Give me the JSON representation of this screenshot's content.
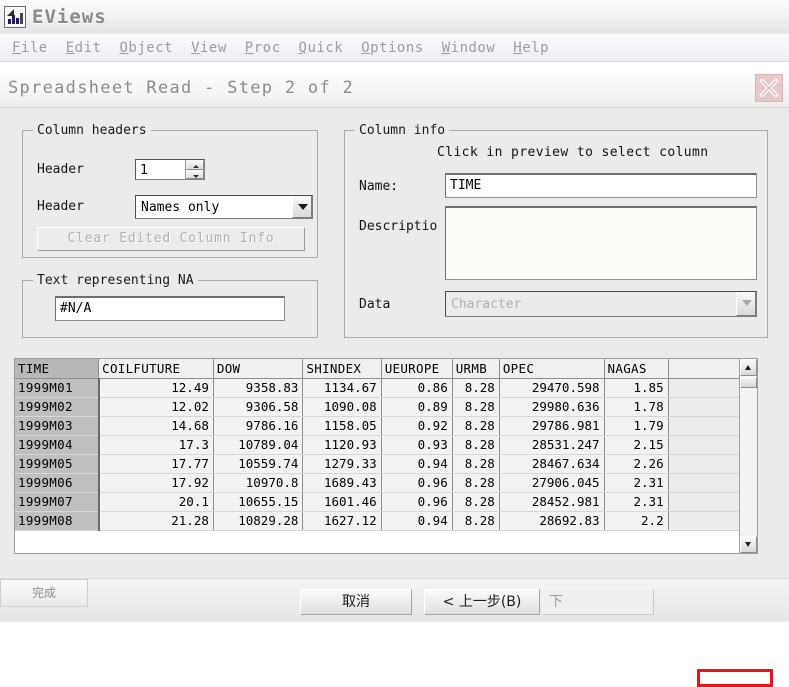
{
  "app": {
    "title": "EViews",
    "icon": "eviews-app-icon"
  },
  "menubar": {
    "items": [
      {
        "label": "File",
        "mnemonic": "F"
      },
      {
        "label": "Edit",
        "mnemonic": "E"
      },
      {
        "label": "Object",
        "mnemonic": "O"
      },
      {
        "label": "View",
        "mnemonic": "V"
      },
      {
        "label": "Proc",
        "mnemonic": "P"
      },
      {
        "label": "Quick",
        "mnemonic": "Q"
      },
      {
        "label": "Options",
        "mnemonic": "O"
      },
      {
        "label": "Window",
        "mnemonic": "W"
      },
      {
        "label": "Help",
        "mnemonic": "H"
      }
    ]
  },
  "dialog": {
    "title": "Spreadsheet Read - Step 2 of 2",
    "close_icon": "close-x-icon",
    "column_headers": {
      "group_title": "Column headers",
      "header_count_label": "Header",
      "header_count_value": "1",
      "header_type_label": "Header",
      "header_type_value": "Names only",
      "clear_button_label": "Clear Edited Column Info",
      "clear_button_enabled": false
    },
    "na_text": {
      "group_title": "Text representing NA",
      "value": "#N/A"
    },
    "column_info": {
      "group_title": "Column info",
      "hint": "Click in preview to select column",
      "name_label": "Name:",
      "name_value": "TIME",
      "description_label": "Descriptio",
      "description_value": "",
      "data_label": "Data",
      "data_value": "Character",
      "data_enabled": false
    },
    "buttons": {
      "cancel": "取消",
      "back": "< 上一步(B)",
      "next": "下",
      "finish": "完成",
      "finish_highlighted": true,
      "highlight_color": "#e8141b"
    }
  },
  "preview": {
    "selected_column": "TIME",
    "columns": [
      "TIME",
      "COILFUTURE",
      "DOW",
      "SHINDEX",
      "UEUROPE",
      "URMB",
      "OPEC",
      "NAGAS"
    ],
    "rows": [
      [
        "1999M01",
        "12.49",
        "9358.83",
        "1134.67",
        "0.86",
        "8.28",
        "29470.598",
        "1.85"
      ],
      [
        "1999M02",
        "12.02",
        "9306.58",
        "1090.08",
        "0.89",
        "8.28",
        "29980.636",
        "1.78"
      ],
      [
        "1999M03",
        "14.68",
        "9786.16",
        "1158.05",
        "0.92",
        "8.28",
        "29786.981",
        "1.79"
      ],
      [
        "1999M04",
        "17.3",
        "10789.04",
        "1120.93",
        "0.93",
        "8.28",
        "28531.247",
        "2.15"
      ],
      [
        "1999M05",
        "17.77",
        "10559.74",
        "1279.33",
        "0.94",
        "8.28",
        "28467.634",
        "2.26"
      ],
      [
        "1999M06",
        "17.92",
        "10970.8",
        "1689.43",
        "0.96",
        "8.28",
        "27906.045",
        "2.31"
      ],
      [
        "1999M07",
        "20.1",
        "10655.15",
        "1601.46",
        "0.96",
        "8.28",
        "28452.981",
        "2.31"
      ],
      [
        "1999M08",
        "21.28",
        "10829.28",
        "1627.12",
        "0.94",
        "8.28",
        "28692.83",
        "2.2"
      ]
    ],
    "scrollbar": {
      "up_icon": "scroll-up-arrow-icon",
      "down_icon": "scroll-down-arrow-icon"
    }
  }
}
